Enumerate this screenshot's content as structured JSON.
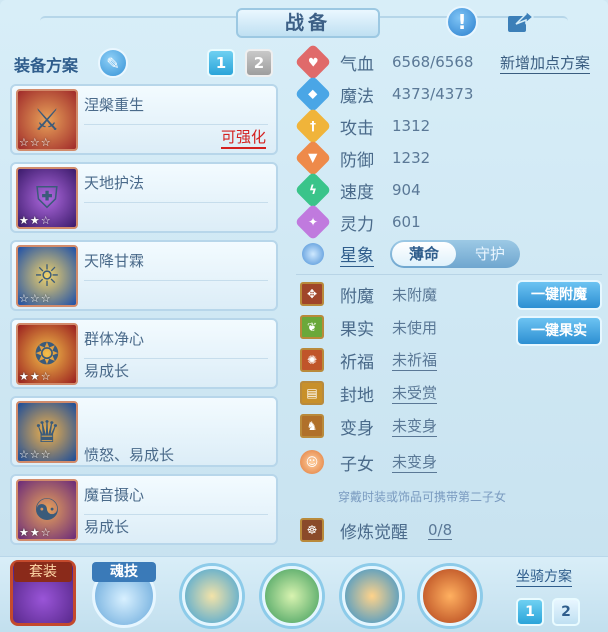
{
  "header": {
    "title": "战备"
  },
  "left": {
    "plan_label": "装备方案",
    "pages": [
      "1",
      "2"
    ],
    "equipment": [
      {
        "name": "涅槃重生",
        "note": "",
        "action": "可强化",
        "stars": "☆☆☆",
        "color": "#c94a4a"
      },
      {
        "name": "天地护法",
        "note": "",
        "action": "",
        "stars": "★★☆",
        "color": "#6a3aa8"
      },
      {
        "name": "天降甘霖",
        "note": "",
        "action": "",
        "stars": "☆☆☆",
        "color": "#2c6fc9"
      },
      {
        "name": "群体净心",
        "note": "易成长",
        "action": "",
        "stars": "★★☆",
        "color": "#c0392b"
      },
      {
        "name": "",
        "note": "愤怒、易成长",
        "action": "",
        "stars": "☆☆☆",
        "color": "#1d6fb8"
      },
      {
        "name": "魔音摄心",
        "note": "易成长",
        "action": "",
        "stars": "★★☆",
        "color": "#8a3a90"
      }
    ]
  },
  "stats": {
    "add_points": "新增加点方案",
    "items": [
      {
        "label": "气血",
        "value": "6568/6568",
        "color": "#e06a6a",
        "glyph": "♥"
      },
      {
        "label": "魔法",
        "value": "4373/4373",
        "color": "#4aa6e6",
        "glyph": "◆"
      },
      {
        "label": "攻击",
        "value": "1312",
        "color": "#f0b43a",
        "glyph": "†"
      },
      {
        "label": "防御",
        "value": "1232",
        "color": "#ee8a4a",
        "glyph": "▼"
      },
      {
        "label": "速度",
        "value": "904",
        "color": "#3ac48a",
        "glyph": "ϟ"
      },
      {
        "label": "灵力",
        "value": "601",
        "color": "#c07ade",
        "glyph": "✦"
      }
    ],
    "xingxiang": {
      "label": "星象",
      "options": [
        "薄命",
        "守护"
      ]
    }
  },
  "features": {
    "items": [
      {
        "label": "附魔",
        "value": "未附魔",
        "underline": false
      },
      {
        "label": "果实",
        "value": "未使用",
        "underline": false
      },
      {
        "label": "祈福",
        "value": "未祈福",
        "underline": true
      },
      {
        "label": "封地",
        "value": "未受赏",
        "underline": true
      },
      {
        "label": "变身",
        "value": "未变身",
        "underline": true
      },
      {
        "label": "子女",
        "value": "未变身",
        "underline": true
      }
    ],
    "buttons": [
      "一键附魔",
      "一键果实"
    ],
    "hint": "穿戴时装或饰品可携带第二子女",
    "cultivation": {
      "label": "修炼觉醒",
      "value": "0/8"
    }
  },
  "bottom": {
    "suit_label": "套装",
    "soul_label": "魂技",
    "mount_label": "坐骑方案",
    "mount_pages": [
      "1",
      "2"
    ]
  },
  "icons": {
    "warn": "exclamation-icon",
    "share": "share-icon",
    "pen": "pencil-icon"
  }
}
